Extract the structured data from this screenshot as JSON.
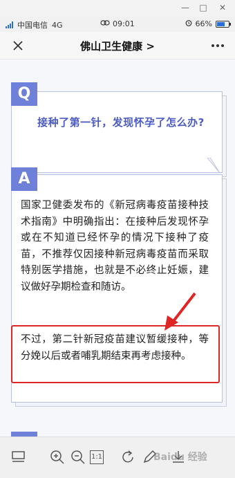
{
  "window": {
    "minimize": "—",
    "maximize": "□",
    "close": "✕"
  },
  "status_bar": {
    "carrier": "中国电信",
    "network": "4G",
    "time": "09:01",
    "battery_text": "66%",
    "battery_level": 0.66,
    "accent": "#2b6fd6"
  },
  "titlebar": {
    "close_icon": "close-icon",
    "title": "佛山卫生健康 >",
    "more_icon": "more-icon"
  },
  "question": {
    "badge": "Q",
    "text": "接种了第一针，发现怀孕了怎么办?"
  },
  "answer": {
    "badge": "A",
    "paragraph1": "国家卫健委发布的《新冠病毒疫苗接种技术指南》中明确指出：在接种后发现怀孕或在不知道已经怀孕的情况下接种了疫苗，不推荐仅因接种新冠病毒疫苗而采取特别医学措施，也就是不必终止妊娠，建议做好孕期检查和随访。",
    "paragraph2": "不过，第二针新冠疫苗建议暂缓接种，等分娩以后或者哺乳期结束再考虑接种。"
  },
  "toolbar": {
    "layout_icon": "layout-icon",
    "zoom_in_icon": "zoom-in-icon",
    "zoom_out_icon": "zoom-out-icon",
    "actual_size_label": "1:1",
    "rotate_icon": "rotate-icon",
    "edit_icon": "edit-icon",
    "download_icon": "download-icon"
  },
  "watermark": "Baidu 经验",
  "colors": {
    "badge": "#6f80d8",
    "question_text": "#4b5bc4",
    "highlight": "#e02525"
  }
}
